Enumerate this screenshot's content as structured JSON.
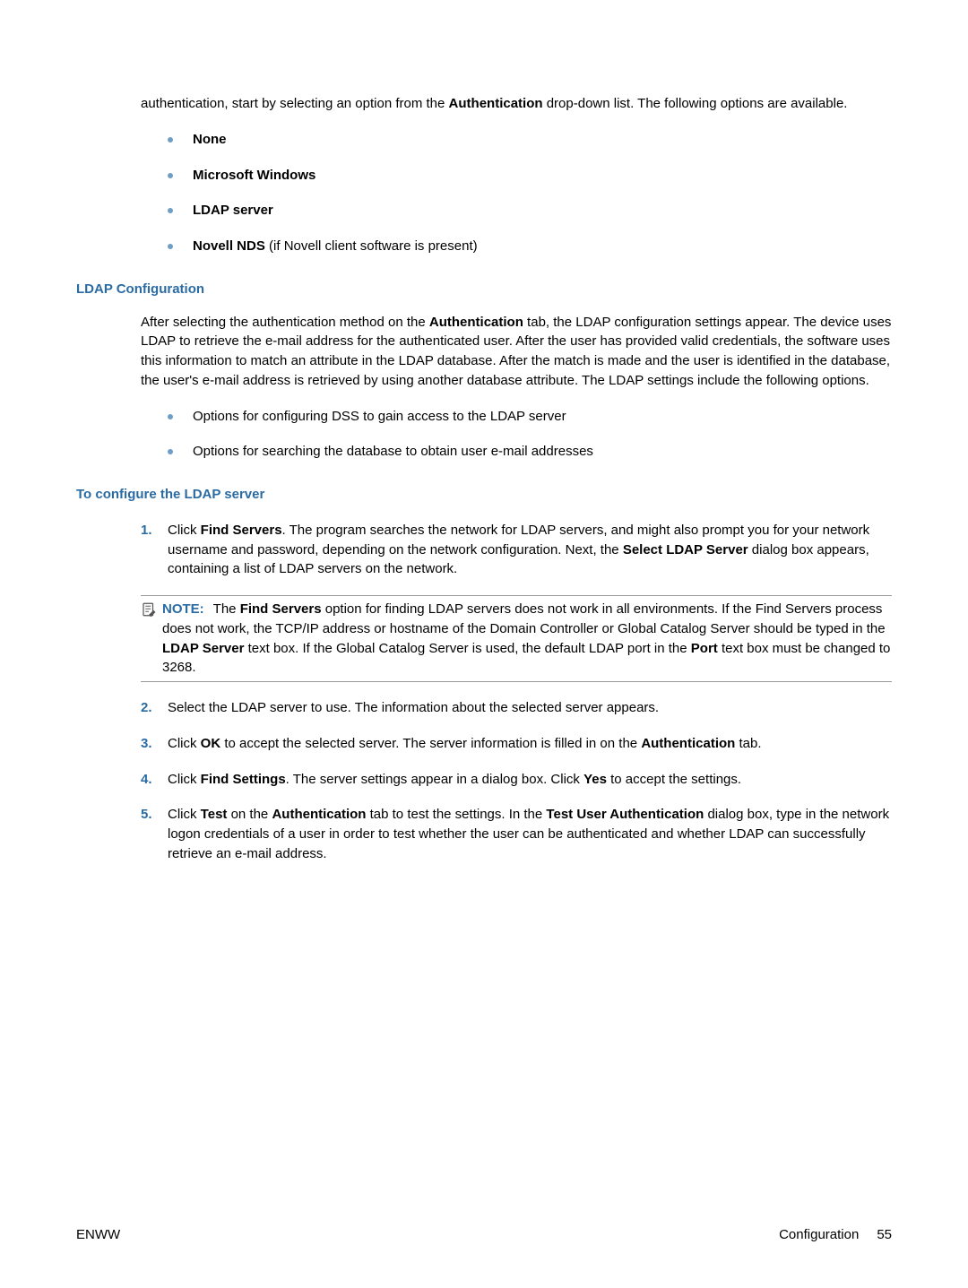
{
  "intro": {
    "p1a": "authentication, start by selecting an option from the ",
    "p1b": "Authentication",
    "p1c": " drop-down list. The following options are available."
  },
  "authOptions": {
    "opt1": "None",
    "opt2": "Microsoft Windows",
    "opt3": "LDAP server",
    "opt4a": "Novell NDS",
    "opt4b": " (if Novell client software is present)"
  },
  "ldapConfig": {
    "heading": "LDAP Configuration",
    "p1a": "After selecting the authentication method on the ",
    "p1b": "Authentication",
    "p1c": " tab, the LDAP configuration settings appear. The device uses LDAP to retrieve the e-mail address for the authenticated user. After the user has provided valid credentials, the software uses this information to match an attribute in the LDAP database. After the match is made and the user is identified in the database, the user's e-mail address is retrieved by using another database attribute. The LDAP settings include the following options.",
    "b1": "Options for configuring DSS to gain access to the LDAP server",
    "b2": "Options for searching the database to obtain user e-mail addresses"
  },
  "configure": {
    "heading": "To configure the LDAP server",
    "step1a": "Click ",
    "step1b": "Find Servers",
    "step1c": ". The program searches the network for LDAP servers, and might also prompt you for your network username and password, depending on the network configuration. Next, the ",
    "step1d": "Select LDAP Server",
    "step1e": " dialog box appears, containing a list of LDAP servers on the network.",
    "noteLabel": "NOTE:",
    "note_a": "The ",
    "note_b": "Find Servers",
    "note_c": " option for finding LDAP servers does not work in all environments. If the Find Servers process does not work, the TCP/IP address or hostname of the Domain Controller or Global Catalog Server should be typed in the ",
    "note_d": "LDAP Server",
    "note_e": " text box. If the Global Catalog Server is used, the default LDAP port in the ",
    "note_f": "Port",
    "note_g": " text box must be changed to 3268.",
    "step2": "Select the LDAP server to use. The information about the selected server appears.",
    "step3a": "Click ",
    "step3b": "OK",
    "step3c": " to accept the selected server. The server information is filled in on the ",
    "step3d": "Authentication",
    "step3e": " tab.",
    "step4a": "Click ",
    "step4b": "Find Settings",
    "step4c": ". The server settings appear in a dialog box. Click ",
    "step4d": "Yes",
    "step4e": " to accept the settings.",
    "step5a": "Click ",
    "step5b": "Test",
    "step5c": " on the ",
    "step5d": "Authentication",
    "step5e": " tab to test the settings. In the ",
    "step5f": "Test User Authentication",
    "step5g": " dialog box, type in the network logon credentials of a user in order to test whether the user can be authenticated and whether LDAP can successfully retrieve an e-mail address."
  },
  "nums": {
    "n1": "1.",
    "n2": "2.",
    "n3": "3.",
    "n4": "4.",
    "n5": "5."
  },
  "footer": {
    "left": "ENWW",
    "rightLabel": "Configuration",
    "pageNum": "55"
  }
}
